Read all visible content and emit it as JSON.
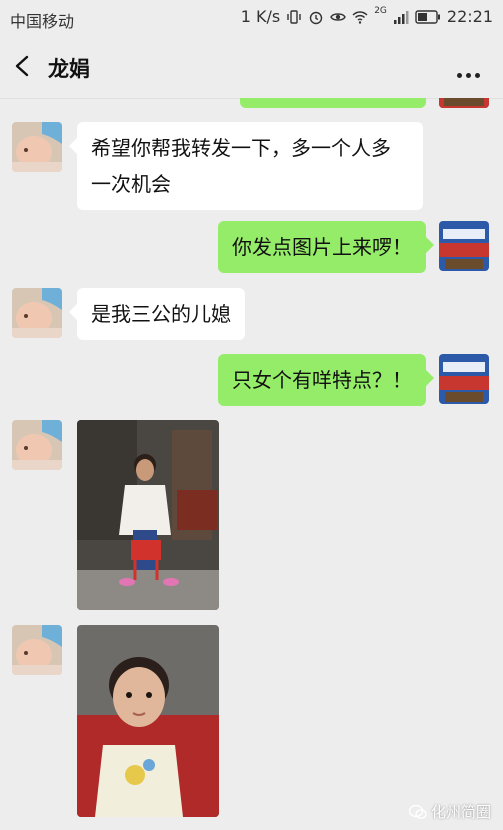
{
  "status_bar": {
    "carrier": "中国移动",
    "speed": "1 K/s",
    "network": "2G",
    "time": "22:21"
  },
  "nav": {
    "title": "龙娟"
  },
  "messages": [
    {
      "from": "contact",
      "text_line1": "希望你帮我转发一下，多一个人多",
      "text_line2": "一次机会"
    },
    {
      "from": "me",
      "text": "你发点图片上来啰！"
    },
    {
      "from": "contact",
      "text": "是我三公的儿媳"
    },
    {
      "from": "me",
      "text": "只女个有咩特点？！"
    },
    {
      "from": "contact",
      "type": "image",
      "subject": "woman-seated-on-red-stool"
    },
    {
      "from": "contact",
      "type": "image",
      "subject": "toddler-portrait"
    }
  ],
  "watermark": "化州简圈",
  "colors": {
    "chat_bg": "#ededed",
    "out_bubble": "#95ec69",
    "in_bubble": "#ffffff"
  }
}
